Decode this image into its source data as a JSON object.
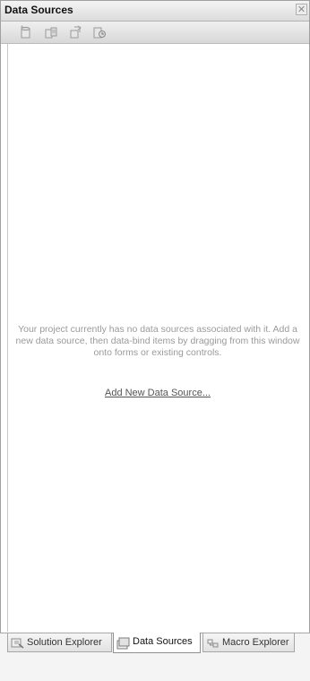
{
  "panel": {
    "title": "Data Sources",
    "close_glyph": "✕"
  },
  "toolbar": {
    "buttons": [
      {
        "icon": "add-data-source-icon"
      },
      {
        "icon": "edit-dataset-designer-icon"
      },
      {
        "icon": "configure-dataset-icon"
      },
      {
        "icon": "refresh-icon"
      }
    ]
  },
  "main": {
    "message": "Your project currently has no data sources associated with it. Add a new data source, then data-bind items by dragging from this window onto forms or existing controls.",
    "add_link": "Add New Data Source..."
  },
  "tabs": [
    {
      "label": "Solution Explorer",
      "icon": "solution-explorer-icon",
      "active": false
    },
    {
      "label": "Data Sources",
      "icon": "data-sources-icon",
      "active": true
    },
    {
      "label": "Macro Explorer",
      "icon": "macro-explorer-icon",
      "active": false
    }
  ]
}
